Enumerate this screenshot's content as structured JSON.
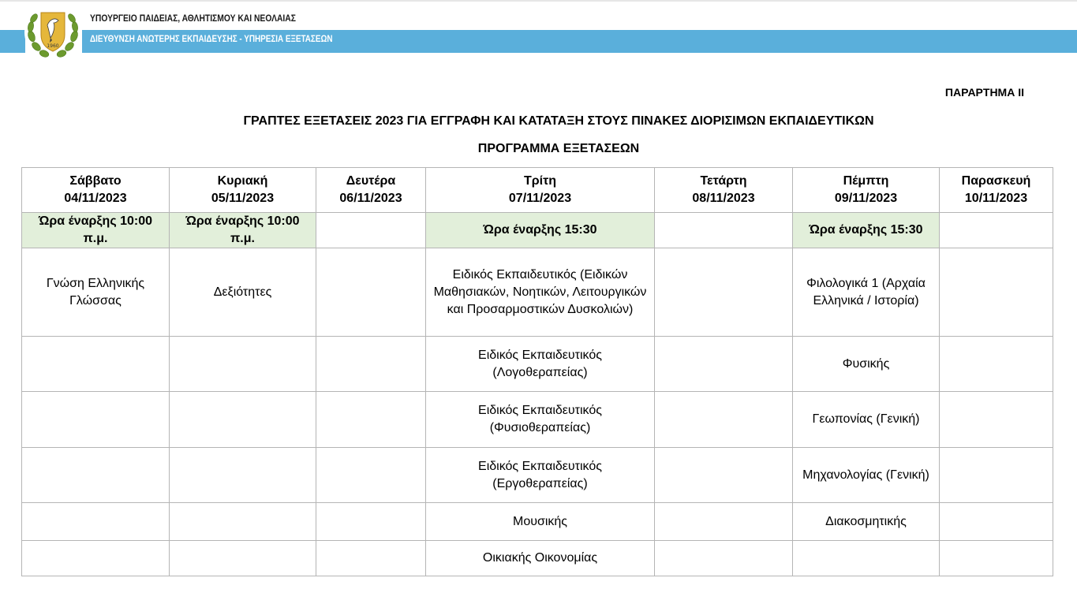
{
  "header": {
    "ministry": "ΥΠΟΥΡΓΕΙΟ ΠΑΙΔΕΙΑΣ, ΑΘΛΗΤΙΣΜΟΥ ΚΑΙ ΝΕΟΛΑΙΑΣ",
    "department": "ΔΙΕΥΘΥΝΣΗ ΑΝΩΤΕΡΗΣ ΕΚΠΑΙΔΕΥΣΗΣ - ΥΠΗΡΕΣΙΑ ΕΞΕΤΑΣΕΩΝ",
    "emblem_icon": "cyprus-coat-of-arms-icon",
    "band_color": "#5aafdb"
  },
  "document": {
    "annex": "ΠΑΡΑΡΤΗΜΑ ΙΙ",
    "title": "ΓΡΑΠΤΕΣ ΕΞΕΤΑΣΕΙΣ 2023 ΓΙΑ ΕΓΓΡΑΦΗ ΚΑΙ ΚΑΤΑΤΑΞΗ ΣΤΟΥΣ ΠΙΝΑΚΕΣ ΔΙΟΡΙΣΙΜΩΝ ΕΚΠΑΙΔΕΥΤΙΚΩΝ",
    "subtitle": "ΠΡΟΓΡΑΜΜΑ ΕΞΕΤΑΣΕΩΝ"
  },
  "table": {
    "highlight_color": "#e2efda",
    "days": [
      {
        "name": "Σάββατο",
        "date": "04/11/2023",
        "start": "Ώρα έναρξης 10:00 π.μ."
      },
      {
        "name": "Κυριακή",
        "date": "05/11/2023",
        "start": "Ώρα έναρξης 10:00 π.μ."
      },
      {
        "name": "Δευτέρα",
        "date": "06/11/2023",
        "start": ""
      },
      {
        "name": "Τρίτη",
        "date": "07/11/2023",
        "start": "Ώρα έναρξης 15:30"
      },
      {
        "name": "Τετάρτη",
        "date": "08/11/2023",
        "start": ""
      },
      {
        "name": "Πέμπτη",
        "date": "09/11/2023",
        "start": "Ώρα έναρξης 15:30"
      },
      {
        "name": "Παρασκευή",
        "date": "10/11/2023",
        "start": ""
      }
    ],
    "rows": [
      [
        "Γνώση Ελληνικής Γλώσσας",
        "Δεξιότητες",
        "",
        "Ειδικός Εκπαιδευτικός (Ειδικών Μαθησιακών, Νοητικών, Λειτουργικών και Προσαρμοστικών Δυσκολιών)",
        "",
        "Φιλολογικά 1 (Αρχαία Ελληνικά / Ιστορία)",
        ""
      ],
      [
        "",
        "",
        "",
        "Ειδικός Εκπαιδευτικός (Λογοθεραπείας)",
        "",
        "Φυσικής",
        ""
      ],
      [
        "",
        "",
        "",
        "Ειδικός Εκπαιδευτικός (Φυσιοθεραπείας)",
        "",
        "Γεωπονίας (Γενική)",
        ""
      ],
      [
        "",
        "",
        "",
        "Ειδικός Εκπαιδευτικός (Εργοθεραπείας)",
        "",
        "Μηχανολογίας (Γενική)",
        ""
      ],
      [
        "",
        "",
        "",
        "Μουσικής",
        "",
        "Διακοσμητικής",
        ""
      ],
      [
        "",
        "",
        "",
        "Οικιακής Οικονομίας",
        "",
        "",
        ""
      ]
    ]
  }
}
